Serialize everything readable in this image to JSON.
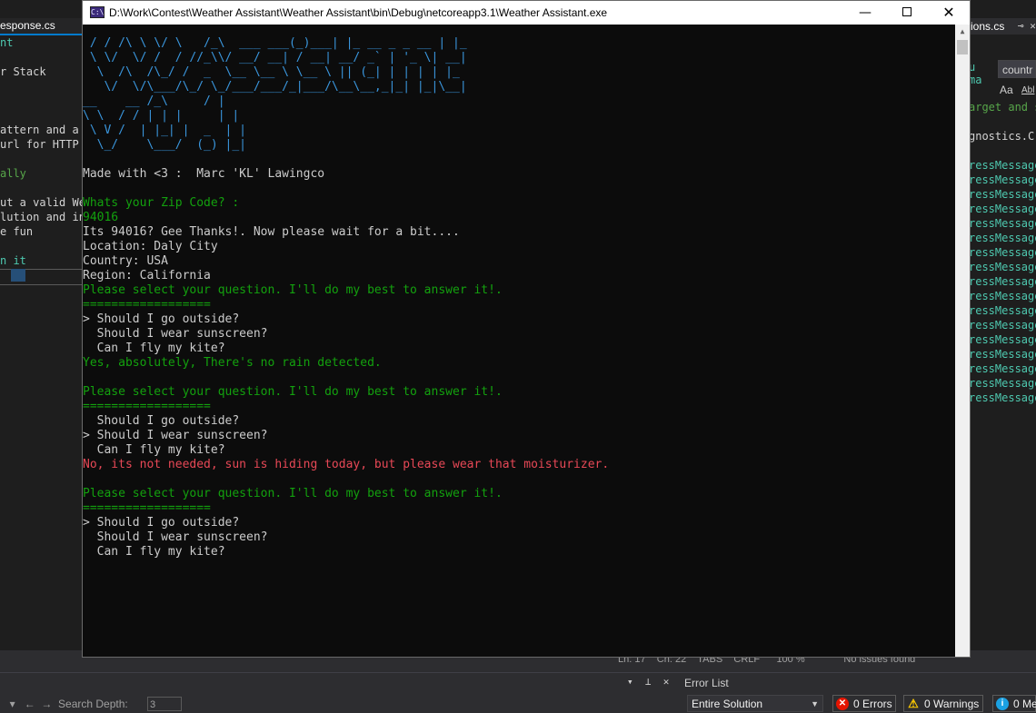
{
  "window": {
    "title": "D:\\Work\\Contest\\Weather Assistant\\Weather Assistant\\bin\\Debug\\netcoreapp3.1\\Weather Assistant.exe",
    "icon_text": "C:\\",
    "minimize": "—",
    "close": "✕"
  },
  "console": {
    "banner": [
      " / / /\\ \\ \\/ \\   /_\\  ___ ___(_)___| |_ __ _ _ __ | |_",
      " \\ \\/  \\/ /  / //_\\\\/ __/ __| / __| __/ _` | '_ \\| __|",
      "  \\  /\\  /\\_/ /  _  \\__ \\__ \\ \\__ \\ || (_| | | | | |_",
      "   \\/  \\/\\___/\\_/ \\_/___/___/_|___/\\__\\__,_|_| |_|\\__|",
      "__    __ /_\\     / |",
      "\\ \\  / / | | |     | |",
      " \\ V /  | |_| |  _  | |",
      "  \\_/    \\___/  (_) |_|"
    ],
    "credit": "Made with <3 :  Marc 'KL' Lawingco",
    "zip_prompt": "Whats your Zip Code? :",
    "zip_input": "94016",
    "thanks": "Its 94016? Gee Thanks!. Now please wait for a bit....",
    "location": "Location: Daly City",
    "country": "Country: USA",
    "region": "Region: California",
    "rounds": [
      {
        "prompt": "Please select your question. I'll do my best to answer it!.",
        "rule": "==================",
        "options": [
          "> Should I go outside?",
          "  Should I wear sunscreen?",
          "  Can I fly my kite?"
        ],
        "answer": "Yes, absolutely, There's no rain detected.",
        "answer_color": "green"
      },
      {
        "prompt": "Please select your question. I'll do my best to answer it!.",
        "rule": "==================",
        "options": [
          "  Should I go outside?",
          "> Should I wear sunscreen?",
          "  Can I fly my kite?"
        ],
        "answer": "No, its not needed, sun is hiding today, but please wear that moisturizer.",
        "answer_color": "red"
      },
      {
        "prompt": "Please select your question. I'll do my best to answer it!.",
        "rule": "==================",
        "options": [
          "> Should I go outside?",
          "  Should I wear sunscreen?",
          "  Can I fly my kite?"
        ]
      }
    ]
  },
  "vs_left": {
    "tab": "esponse.cs",
    "lines": [
      {
        "text": "nt",
        "style": "kw"
      },
      {
        "text": "",
        "style": ""
      },
      {
        "text": "r Stack",
        "style": ""
      },
      {
        "text": "",
        "style": ""
      },
      {
        "text": "",
        "style": ""
      },
      {
        "text": "",
        "style": ""
      },
      {
        "text": "attern and a",
        "style": ""
      },
      {
        "text": "url for HTTP",
        "style": ""
      },
      {
        "text": "",
        "style": ""
      },
      {
        "text": "ally",
        "style": "green"
      },
      {
        "text": "",
        "style": ""
      },
      {
        "text": "ut a valid We",
        "style": ""
      },
      {
        "text": "lution and in",
        "style": ""
      },
      {
        "text": "e fun",
        "style": ""
      },
      {
        "text": "",
        "style": ""
      },
      {
        "text": "n it",
        "style": "kw"
      }
    ]
  },
  "vs_right": {
    "tab": "ions.cs",
    "search_text": "countr",
    "aa": "Aa",
    "abl": "Abl",
    "line1": "u",
    "line2": "ma",
    "line3": "arget and s",
    "line4": "gnostics.C",
    "repeated": "ressMessage",
    "repeated_count": 17
  },
  "vs_status": {
    "text": "Ln: 17    Ch: 22    TABS    CRLF      100 %              No issues found"
  },
  "vs_bottom": {
    "search_depth_label": "  ▾   ←  →  Search Depth:",
    "search_depth_value": "3",
    "panel_controls": "▾  ⊥  ✕",
    "error_list_title": "Error List",
    "scope": "Entire Solution",
    "errors": "0 Errors",
    "warnings": "0 Warnings",
    "messages": "0 Me"
  },
  "colors": {
    "console_bg": "#0c0c0c",
    "console_text": "#cccccc",
    "console_cyan": "#3a96dd",
    "console_green": "#13a10e",
    "console_red": "#e74856"
  }
}
